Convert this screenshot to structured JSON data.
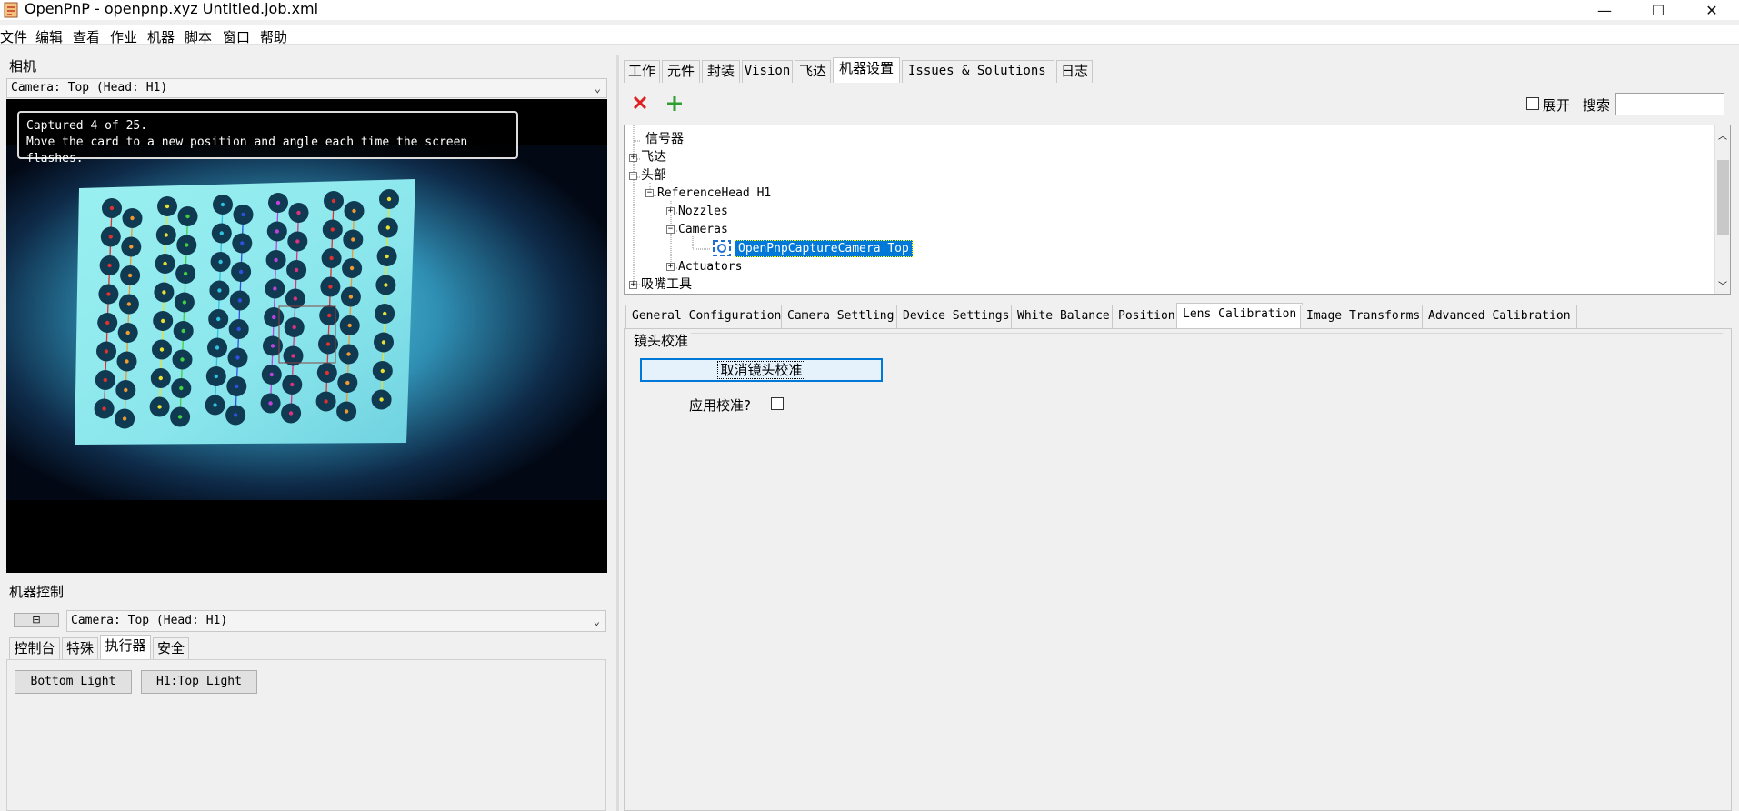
{
  "window": {
    "title": "OpenPnP - openpnp.xyz Untitled.job.xml",
    "minimize": "—",
    "maximize": "☐",
    "close": "✕"
  },
  "menu": [
    "文件",
    "编辑",
    "查看",
    "作业",
    "机器",
    "脚本",
    "窗口",
    "帮助"
  ],
  "camera_panel": {
    "label": "相机",
    "camera_select": "Camera: Top (Head: H1)",
    "overlay_line1": "Captured 4 of 25.",
    "overlay_line2": "Move the card to a new position and angle each time the screen flashes."
  },
  "machine_control": {
    "label": "机器控制",
    "camera_select": "Camera: Top (Head: H1)",
    "tabs": [
      "控制台",
      "特殊",
      "执行器",
      "安全"
    ],
    "active_tab": "执行器",
    "buttons": [
      "Bottom Light",
      "H1:Top Light"
    ]
  },
  "main_tabs": [
    "工作",
    "元件",
    "封装",
    "Vision",
    "飞达",
    "机器设置",
    "Issues & Solutions",
    "日志"
  ],
  "active_main_tab": "机器设置",
  "toolbar": {
    "expand_label": "展开",
    "search_label": "搜索",
    "search_value": ""
  },
  "tree": {
    "items": [
      {
        "label": "信号器"
      },
      {
        "label": "飞达"
      },
      {
        "label": "头部"
      },
      {
        "label": "ReferenceHead H1"
      },
      {
        "label": "Nozzles"
      },
      {
        "label": "Cameras"
      },
      {
        "label": "OpenPnpCaptureCamera Top"
      },
      {
        "label": "Actuators"
      },
      {
        "label": "吸嘴工具"
      }
    ]
  },
  "config_tabs": [
    "General Configuration",
    "Camera Settling",
    "Device Settings",
    "White Balance",
    "Position",
    "Lens Calibration",
    "Image Transforms",
    "Advanced Calibration"
  ],
  "active_config_tab": "Lens Calibration",
  "lens_calibration": {
    "group_label": "镜头校准",
    "cancel_button": "取消镜头校准",
    "apply_label": "应用校准?"
  },
  "colors": {
    "selection": "#0078d7",
    "delete": "#e02020",
    "add": "#2e9e2e",
    "issue_dot": "#1357d8"
  }
}
